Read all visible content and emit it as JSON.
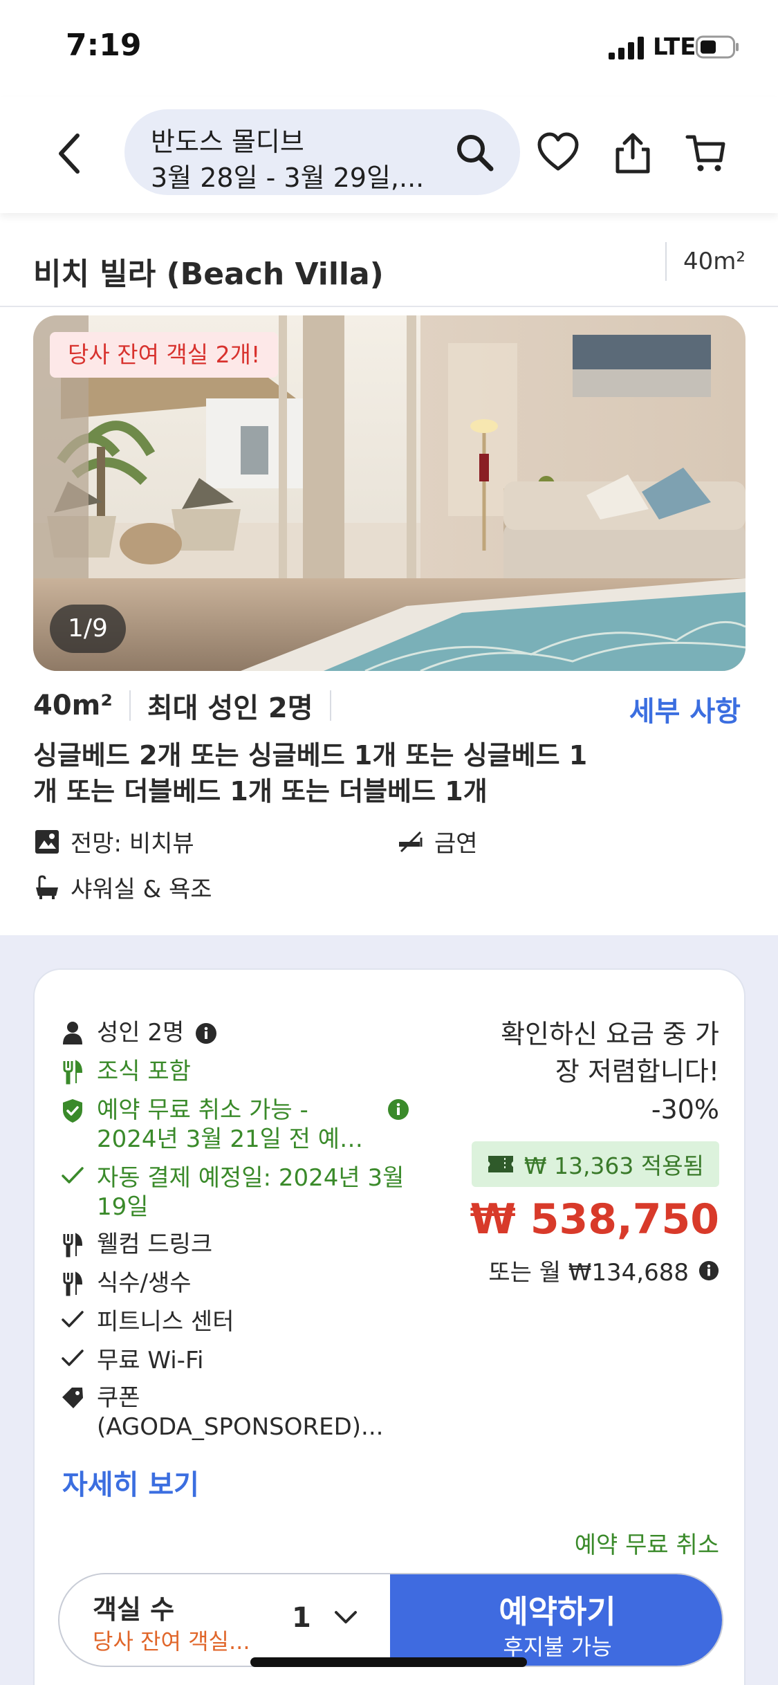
{
  "status": {
    "time": "7:19",
    "network": "LTE"
  },
  "header": {
    "destination": "반도스 몰디브",
    "dates": "3월 28일 - 3월 29일,..."
  },
  "room": {
    "title": "비치 빌라 (Beach Villa)",
    "size_top": "40m²",
    "scarcity_badge": "당사 잔여 객실 2개!",
    "photo_counter": "1/9",
    "size": "40m²",
    "occupancy": "최대 성인 2명",
    "details_link": "세부 사항",
    "beds": "싱글베드 2개 또는 싱글베드 1개 또는 싱글베드 1개 또는 더블베드 1개 또는 더블베드 1개",
    "amenities": {
      "view": "전망: 비치뷰",
      "smoking": "금연",
      "bath": "샤워실 & 욕조"
    }
  },
  "offer": {
    "features": [
      {
        "icon": "person-icon",
        "text": "성인 2명"
      },
      {
        "icon": "fork-knife-icon",
        "text": "조식 포함"
      },
      {
        "icon": "shield-check-icon",
        "text": "예약 무료 취소 가능 - 2024년 3월 21일 전 예…"
      },
      {
        "icon": "check-icon",
        "text": "자동 결제 예정일: 2024년 3월 19일"
      },
      {
        "icon": "fork-knife-icon",
        "text": "웰컴 드링크"
      },
      {
        "icon": "fork-knife-icon",
        "text": "식수/생수"
      },
      {
        "icon": "check-icon",
        "text": "피트니스 센터"
      },
      {
        "icon": "check-icon",
        "text": "무료 Wi-Fi"
      },
      {
        "icon": "tag-icon",
        "text": "쿠폰 (AGODA_SPONSORED)..."
      }
    ],
    "more_link": "자세히 보기",
    "cheapest_note": "확인하신 요금 중 가장 저렴합니다!",
    "discount": "-30%",
    "coupon_applied": "₩ 13,363 적용됨",
    "price": "₩ 538,750",
    "monthly": "또는 월 ₩134,688",
    "free_cancel": "예약 무료 취소",
    "rooms_label": "객실 수",
    "rooms_sub": "당사 잔여 객실...",
    "rooms_count": "1",
    "book_button": "예약하기",
    "book_sub": "후지불 가능"
  },
  "colors": {
    "accent_blue": "#3f6be0",
    "price_red": "#d83a2a",
    "green": "#3a8a2a",
    "section_bg": "#eaecf7"
  }
}
